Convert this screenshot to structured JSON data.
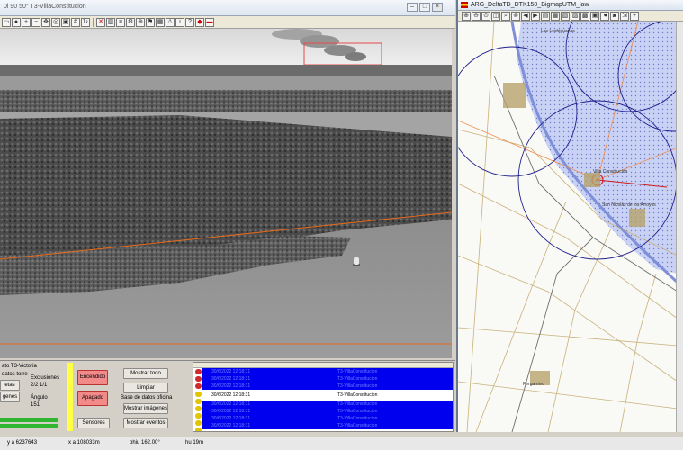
{
  "camera_window": {
    "title": "0l 90 50° T3-VillaConstitucion",
    "buttons": [
      "–",
      "□",
      "×"
    ]
  },
  "map_window": {
    "title": "ARG_DeltaTD_DTK150_BigmapUTM_law",
    "places": [
      "Las Lechiguanas",
      "Villa Constitución",
      "San Nicolás de los Arroyos",
      "Pergamino"
    ]
  },
  "panel": {
    "tower_label": "ato T3-Victoria",
    "datos_torre": "datos torre",
    "exclusiones_label": "Exclusiones",
    "exclusiones_value": "2/2  1/1",
    "etas_button": "etas",
    "genes_button": "genes",
    "angulo_label": "Ángulo",
    "angulo_value": "151",
    "encendido": "Encendido",
    "apagado": "Apagado",
    "sensores": "Sensores",
    "mostrar_todo": "Mostrar todo",
    "limpiar": "Limpiar",
    "base_datos": "Base de datos oficina",
    "mostrar_imagenes": "Mostrar imágenes",
    "mostrar_eventos": "Mostrar eventos"
  },
  "events": {
    "selected_date": "30/6/2022 12:18:31",
    "selected_location": "T3-VillaConstitucion",
    "row_date": "30/6/2022 12:18:31",
    "row_location": "T3-VillaConstitucion"
  },
  "statusbar": {
    "y": "y a 6237643",
    "x": "x a 108033m",
    "phiu": "phiu 162.00°",
    "hu": "hu 19m"
  },
  "colors": {
    "event_row": "#0000ee",
    "alarm_red": "#f28a8a",
    "highlight_yellow": "#ffff44",
    "status_green": "#2fb52f",
    "map_water": "#c9d2f5",
    "map_circle": "#1e1e8c"
  }
}
